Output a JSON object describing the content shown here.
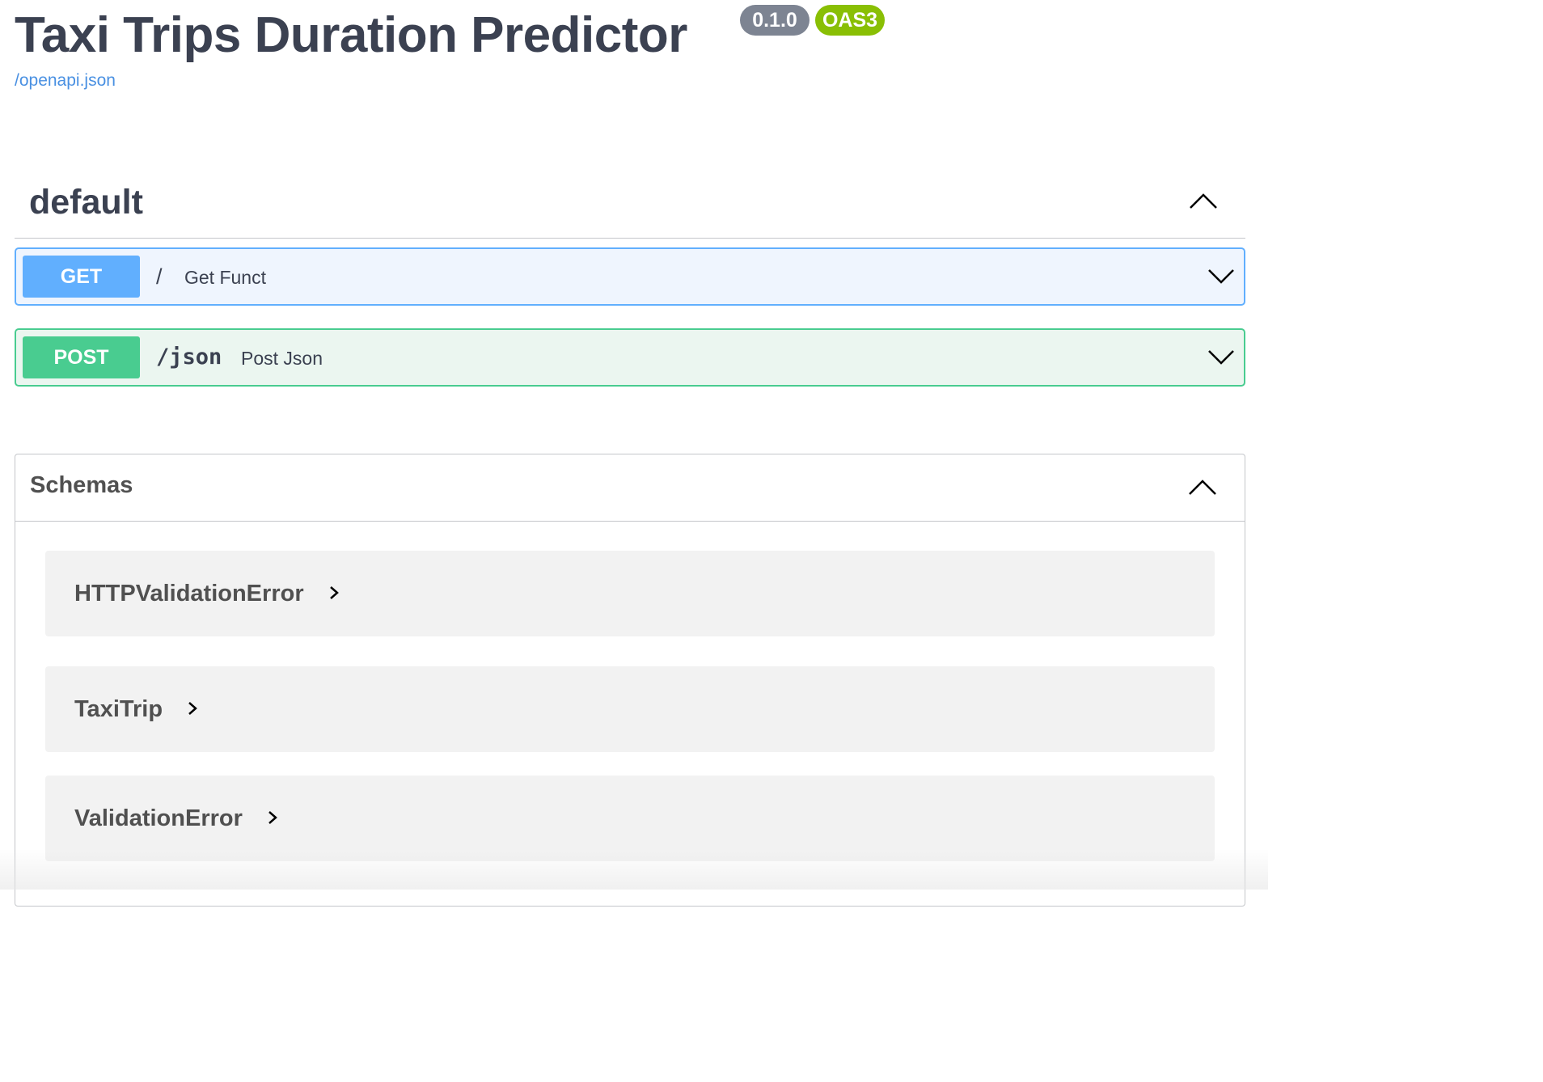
{
  "info": {
    "title": "Taxi Trips Duration Predictor",
    "version": "0.1.0",
    "oas_badge": "OAS3",
    "spec_link": "/openapi.json"
  },
  "tag": {
    "name": "default",
    "toggle_icon": "chevron-up-icon",
    "operations": [
      {
        "method": "GET",
        "path": "/",
        "summary": "Get Funct",
        "color": "#61affe",
        "toggle_icon": "chevron-down-icon"
      },
      {
        "method": "POST",
        "path": "/json",
        "summary": "Post Json",
        "color": "#49cc90",
        "toggle_icon": "chevron-down-icon"
      }
    ]
  },
  "schemas": {
    "title": "Schemas",
    "toggle_icon": "chevron-up-icon",
    "items": [
      {
        "name": "HTTPValidationError",
        "icon": "chevron-right-icon"
      },
      {
        "name": "TaxiTrip",
        "icon": "chevron-right-icon"
      },
      {
        "name": "ValidationError",
        "icon": "chevron-right-icon"
      }
    ]
  },
  "colors": {
    "text": "#3b4151",
    "link": "#4990e2",
    "version_badge": "#7d8492",
    "oas_badge": "#89bf04",
    "get": "#61affe",
    "post": "#49cc90",
    "model_bg": "#f2f2f2"
  }
}
